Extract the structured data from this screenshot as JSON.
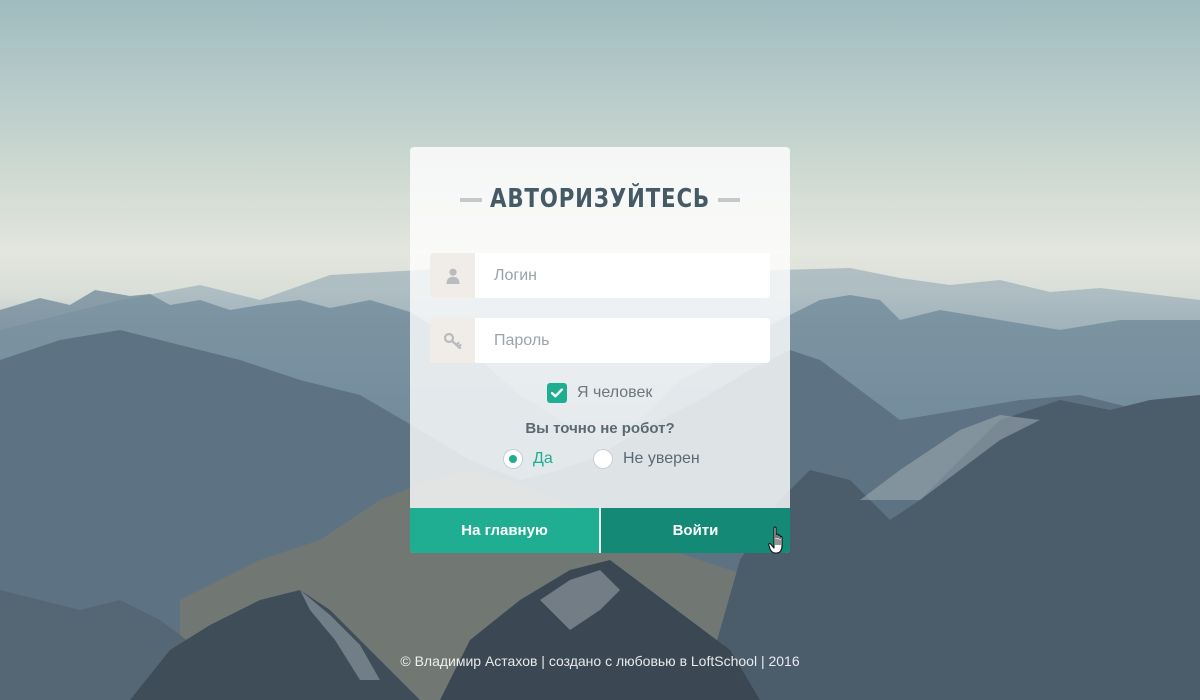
{
  "card": {
    "title": "АВТОРИЗУЙТЕСЬ",
    "login": {
      "placeholder": "Логин",
      "icon": "user-icon"
    },
    "password": {
      "placeholder": "Пароль",
      "icon": "key-icon"
    },
    "human_checkbox": {
      "label": "Я человек",
      "checked": true
    },
    "robot_question": "Вы точно не робот?",
    "robot_options": [
      {
        "label": "Да",
        "selected": true
      },
      {
        "label": "Не уверен",
        "selected": false
      }
    ],
    "buttons": {
      "home_label": "На главную",
      "login_label": "Войти"
    }
  },
  "footer": {
    "text": "© Владимир Астахов | создано с любовью в LoftSchool | 2016"
  },
  "colors": {
    "accent": "#1fae91",
    "accent_dark": "#148a76",
    "title": "#455a64"
  }
}
